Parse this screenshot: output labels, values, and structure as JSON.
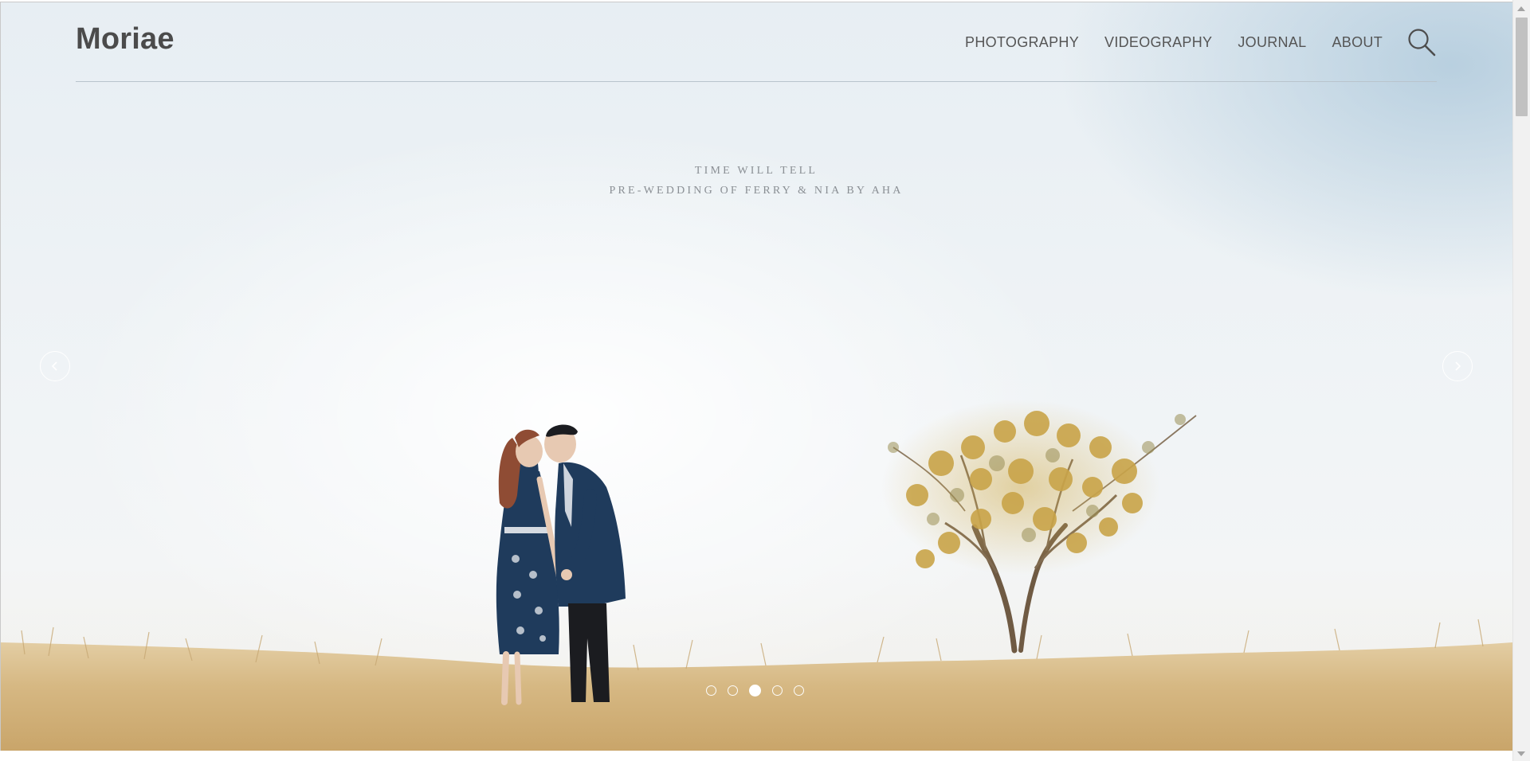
{
  "site": {
    "logo": "Moriae"
  },
  "nav": {
    "items": [
      {
        "label": "PHOTOGRAPHY"
      },
      {
        "label": "VIDEOGRAPHY"
      },
      {
        "label": "JOURNAL"
      },
      {
        "label": "ABOUT"
      }
    ],
    "search_icon": "search-icon"
  },
  "hero": {
    "caption_line1": "TIME WILL TELL",
    "caption_line2": "PRE-WEDDING OF FERRY & NIA BY AHA",
    "prev_icon": "chevron-left-icon",
    "next_icon": "chevron-right-icon",
    "slide_count": 5,
    "active_slide": 3
  },
  "colors": {
    "logo": "#4b4b4b",
    "nav_text": "#555555",
    "caption_text": "#8a8f94",
    "sky": "#edf2f5",
    "grass": "#d2b27c",
    "couple_outfit": "#1f3b5c",
    "tree_foliage": "#c9a449"
  }
}
